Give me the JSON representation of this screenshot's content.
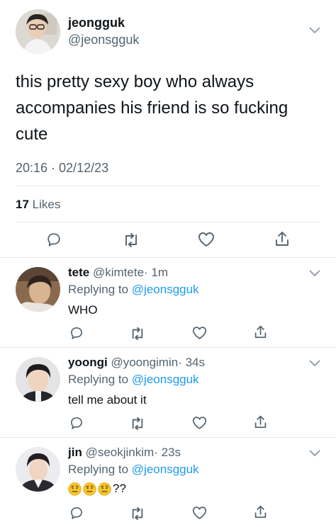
{
  "tweet": {
    "display_name": "jeongguk",
    "handle": "@jeonsgguk",
    "text_lines": [
      "this pretty sexy boy who always",
      "accompanies his friend is so fucking",
      "cute"
    ],
    "timestamp": "20:16 · 02/12/23",
    "likes_count": "17",
    "likes_label": "Likes"
  },
  "replies": [
    {
      "display_name": "tete",
      "handle": "@kimtete",
      "time": "· 1m",
      "replying_label": "Replying to",
      "replying_handle": "@jeonsgguk",
      "text": "WHO"
    },
    {
      "display_name": "yoongi",
      "handle": "@yoongimin",
      "time": "· 34s",
      "replying_label": "Replying to",
      "replying_handle": "@jeonsgguk",
      "text": "tell me about it"
    },
    {
      "display_name": "jin",
      "handle": "@seokjinkim",
      "time": "· 23s",
      "replying_label": "Replying to",
      "replying_handle": "@jeonsgguk",
      "text": "??",
      "emoji_count": 3
    }
  ],
  "colors": {
    "link": "#1d9bf0",
    "muted": "#536471",
    "icon": "#536471"
  }
}
